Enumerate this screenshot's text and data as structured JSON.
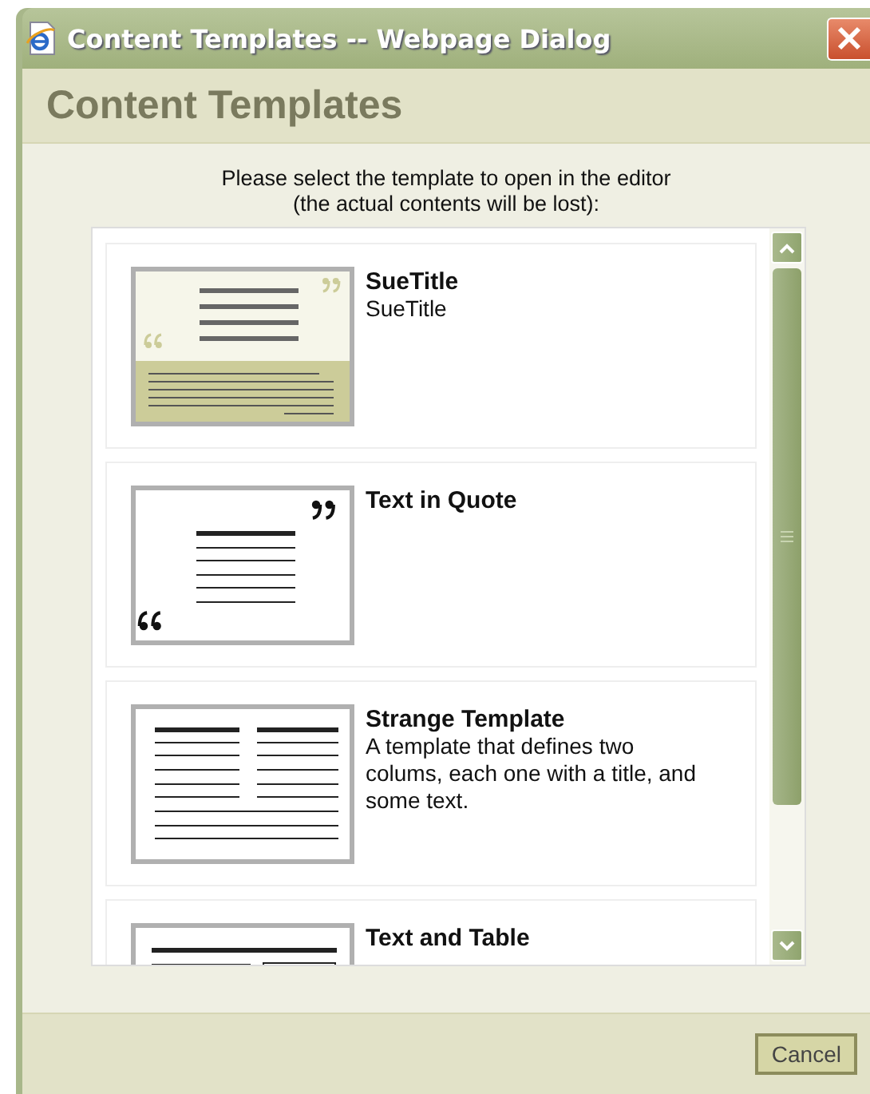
{
  "window": {
    "title": "Content Templates -- Webpage Dialog"
  },
  "header": {
    "title": "Content Templates"
  },
  "instructions": [
    "Please select the template to open in the editor",
    "(the actual contents will be lost):"
  ],
  "templates": [
    {
      "kind": "title",
      "name": "SueTitle",
      "description": "SueTitle"
    },
    {
      "kind": "quote",
      "name": "Text in Quote"
    },
    {
      "kind": "columns",
      "name": "Strange Template",
      "description": "A template that defines two colums, each one with a title, and some text."
    },
    {
      "kind": "table",
      "name": "Text and Table"
    }
  ],
  "buttons": [
    "Cancel"
  ]
}
